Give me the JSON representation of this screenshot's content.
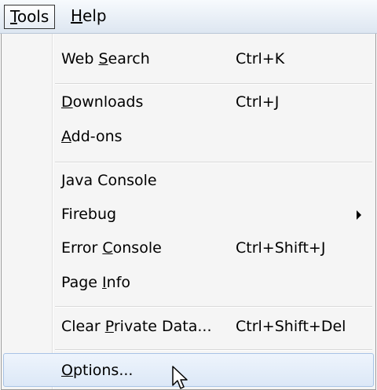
{
  "menubar": {
    "items": [
      {
        "pre": "",
        "u": "T",
        "post": "ools"
      },
      {
        "pre": "",
        "u": "H",
        "post": "elp"
      }
    ]
  },
  "menu": {
    "items": [
      {
        "pre": "Web ",
        "u": "S",
        "post": "earch",
        "shortcut": "Ctrl+K"
      },
      {
        "pre": "",
        "u": "D",
        "post": "ownloads",
        "shortcut": "Ctrl+J"
      },
      {
        "pre": "",
        "u": "A",
        "post": "dd-ons",
        "shortcut": ""
      },
      {
        "pre": "",
        "u": "J",
        "post": "ava Console",
        "shortcut": ""
      },
      {
        "pre": "Firebug",
        "u": "",
        "post": "",
        "shortcut": ""
      },
      {
        "pre": "Error ",
        "u": "C",
        "post": "onsole",
        "shortcut": "Ctrl+Shift+J"
      },
      {
        "pre": "Page ",
        "u": "I",
        "post": "nfo",
        "shortcut": ""
      },
      {
        "pre": "Clear ",
        "u": "P",
        "post": "rivate Data...",
        "shortcut": "Ctrl+Shift+Del"
      },
      {
        "pre": "",
        "u": "O",
        "post": "ptions...",
        "shortcut": ""
      }
    ]
  },
  "icons": {
    "submenu": "chevron-right-icon",
    "cursor": "mouse-pointer-icon"
  },
  "colors": {
    "highlight_border": "#a8c3e6",
    "highlight_fill": "#dce8f7",
    "menu_background": "#f5f5f5"
  }
}
